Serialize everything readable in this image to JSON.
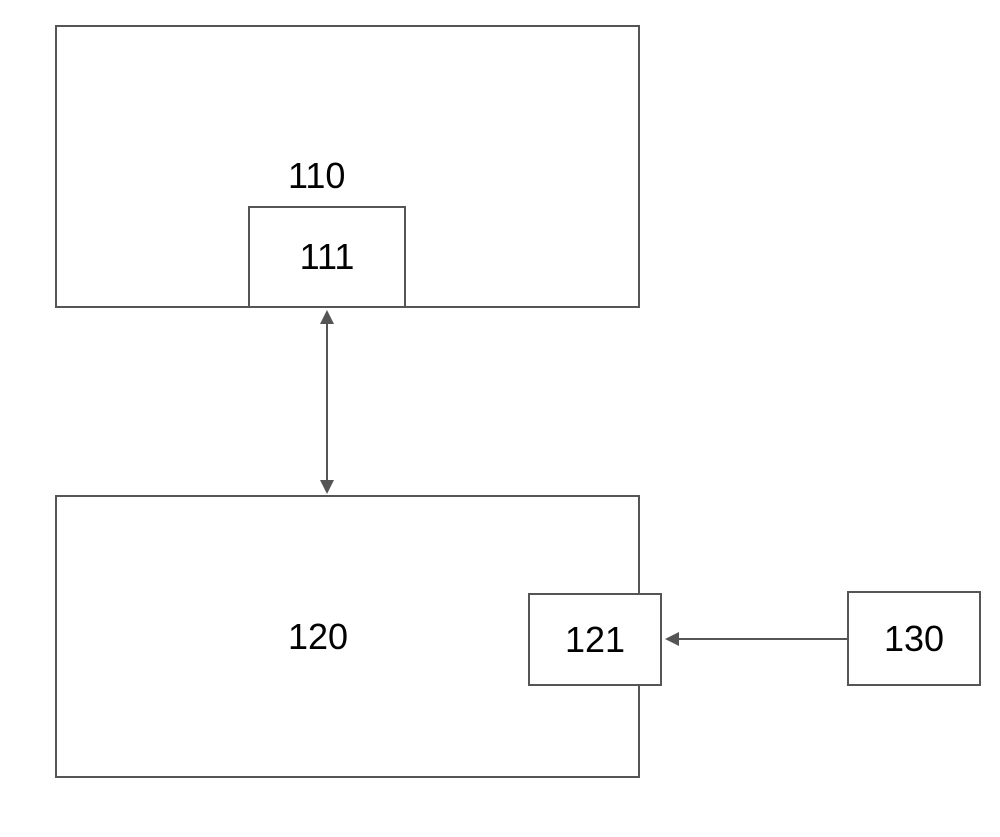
{
  "diagram": {
    "box_110": "110",
    "box_111": "111",
    "box_120": "120",
    "box_121": "121",
    "box_130": "130"
  }
}
